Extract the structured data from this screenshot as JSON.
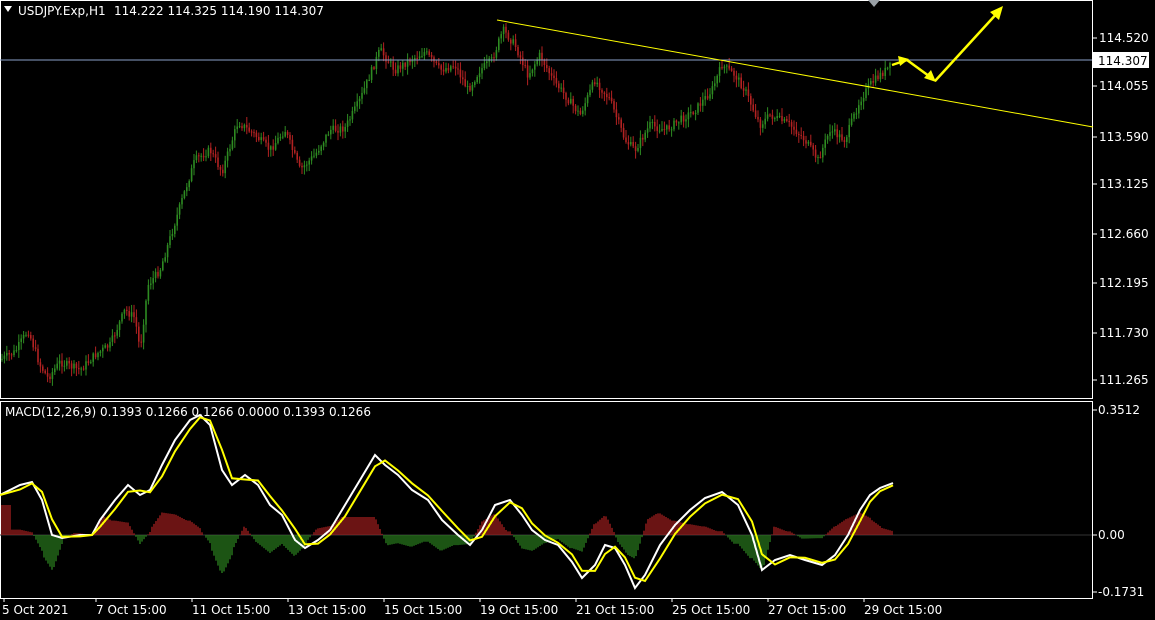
{
  "header": {
    "symbol": "USDJPY.Exp,H1",
    "ohlc": "114.222 114.325 114.190 114.307",
    "menu_icon": "triangle-down-icon"
  },
  "price_axis": {
    "ticks": [
      "114.520",
      "114.055",
      "113.590",
      "113.125",
      "112.660",
      "112.195",
      "111.730",
      "111.265"
    ],
    "current_price": "114.307"
  },
  "macd": {
    "label": "MACD(12,26,9) 0.1393 0.1266 0.1266 0.0000 0.1393 0.1266",
    "axis_ticks": [
      "0.3512",
      "0.00",
      "-0.1731"
    ]
  },
  "time_axis": {
    "labels": [
      "5 Oct 2021",
      "7 Oct 15:00",
      "11 Oct 15:00",
      "13 Oct 15:00",
      "15 Oct 15:00",
      "19 Oct 15:00",
      "21 Oct 15:00",
      "25 Oct 15:00",
      "27 Oct 15:00",
      "29 Oct 15:00"
    ]
  },
  "colors": {
    "background": "#000000",
    "bull_candle": "#2e8b22",
    "bear_candle": "#b22222",
    "trendline": "#ffff00",
    "macd_line": "#ffffff",
    "signal_line": "#ffff00",
    "hist_pos": "#b22222",
    "hist_neg": "#2e8b22",
    "price_line": "#8aa0c8"
  }
}
